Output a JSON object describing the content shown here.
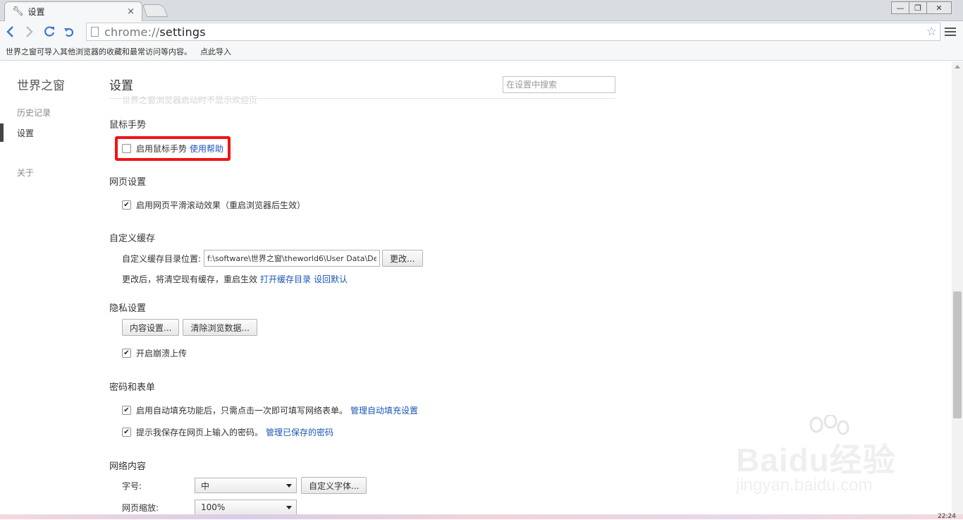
{
  "window": {
    "tab_title": "设置",
    "tab_close": "×",
    "controls": {
      "minimize": "—",
      "restore": "❐",
      "close": "✕"
    }
  },
  "toolbar": {
    "url_scheme": "chrome://",
    "url_path": "settings"
  },
  "infobar": {
    "message": "世界之窗可导入其他浏览器的收藏和最常访问等内容。",
    "import_link": "点此导入"
  },
  "sidebar": {
    "brand": "世界之窗",
    "items": [
      {
        "label": "历史记录"
      },
      {
        "label": "设置"
      },
      {
        "label": "关于"
      }
    ]
  },
  "main": {
    "title": "设置",
    "search_placeholder": "在设置中搜索",
    "ghost_text": "世界之窗浏览器启动时不显示欢迎页",
    "mouse_gesture": {
      "title": "鼠标手势",
      "enable_label": "启用鼠标手势",
      "enable_checked": false,
      "help_link": "使用帮助"
    },
    "webpage": {
      "title": "网页设置",
      "smooth_label": "启用网页平滑滚动效果（重启浏览器后生效）",
      "smooth_checked": true
    },
    "cache": {
      "title": "自定义缓存",
      "dir_label": "自定义缓存目录位置:",
      "dir_value": "f:\\software\\世界之窗\\theworld6\\User Data\\De",
      "change_button": "更改...",
      "note": "更改后，将清空现有缓存，重启生效",
      "open_link": "打开缓存目录",
      "reset_link": "设回默认"
    },
    "privacy": {
      "title": "隐私设置",
      "content_button": "内容设置...",
      "clear_button": "清除浏览数据...",
      "crash_label": "开启崩溃上传",
      "crash_checked": true
    },
    "passwords": {
      "title": "密码和表单",
      "autofill_label": "启用自动填充功能后，只需点击一次即可填写网络表单。",
      "autofill_link": "管理自动填充设置",
      "autofill_checked": true,
      "save_label": "提示我保存在网页上输入的密码。",
      "save_link": "管理已保存的密码",
      "save_checked": true
    },
    "web_content": {
      "title": "网络内容",
      "font_size_label": "字号:",
      "font_size_value": "中",
      "custom_font_button": "自定义字体...",
      "zoom_label": "网页缩放:",
      "zoom_value": "100%"
    }
  },
  "watermark": {
    "brand": "Baidu经验",
    "url": "jingyan.baidu.com"
  },
  "taskbar": {
    "clock": "22:24"
  },
  "colors": {
    "link": "#1a56b8",
    "highlight": "#f01414",
    "nav_icon": "#3b79cc"
  }
}
